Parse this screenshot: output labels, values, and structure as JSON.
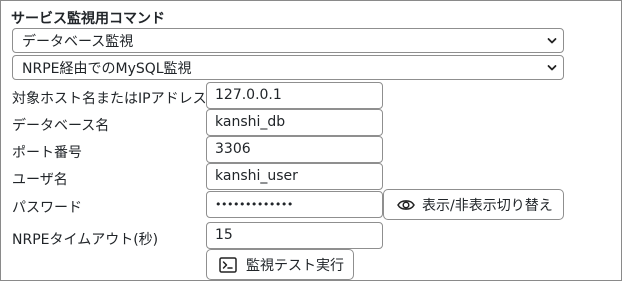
{
  "section": {
    "title": "サービス監視用コマンド"
  },
  "selects": {
    "category": {
      "value": "データベース監視",
      "icon": "chevron-down-icon"
    },
    "command": {
      "value": "NRPE経由でのMySQL監視",
      "icon": "chevron-down-icon"
    }
  },
  "fields": {
    "host": {
      "label": "対象ホスト名またはIPアドレス",
      "value": "127.0.0.1"
    },
    "database": {
      "label": "データベース名",
      "value": "kanshi_db"
    },
    "port": {
      "label": "ポート番号",
      "value": "3306"
    },
    "user": {
      "label": "ユーザ名",
      "value": "kanshi_user"
    },
    "password": {
      "label": "パスワード",
      "value": "•••••••••••••"
    },
    "timeout": {
      "label": "NRPEタイムアウト(秒)",
      "value": "15"
    }
  },
  "buttons": {
    "toggle_password": {
      "label": "表示/非表示切り替え",
      "icon": "eye-icon"
    },
    "run_test": {
      "label": "監視テスト実行",
      "icon": "terminal-icon"
    }
  }
}
